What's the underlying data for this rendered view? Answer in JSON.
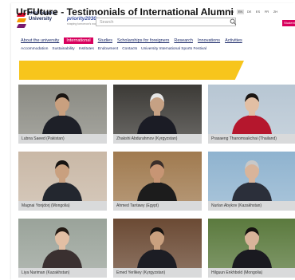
{
  "header": {
    "logo_lines": [
      "Ural Federal",
      "University"
    ],
    "priority_label": "priority2030",
    "priority_sub": "shaping tomorrow's world, today",
    "search_placeholder": "Search",
    "languages": [
      "RU",
      "EN",
      "DE",
      "ES",
      "FR",
      "ZH"
    ],
    "active_language": "EN",
    "student_button": "Student"
  },
  "nav": {
    "primary": [
      "About the university",
      "International",
      "Studies",
      "Scholarships for foreigners",
      "Research",
      "Innovations",
      "Activities"
    ],
    "active": "International",
    "secondary": [
      "Accommodation",
      "Sustainability",
      "Institutes",
      "Endowment",
      "Contacts",
      "University International Sports Festival"
    ]
  },
  "page_title": "UrFUture - Testimonials of International Alumni",
  "alumni": [
    {
      "caption": "Lubna Saeed (Pakistan)",
      "icon": "person-photo",
      "bg": "#8a8a82",
      "skin": "#c9a07f",
      "cloth": "#1e2028",
      "hair": "#1a1512"
    },
    {
      "caption": "Zhakshi Abdurahmov (Kyrgyzstan)",
      "icon": "person-photo",
      "bg": "#3c3a36",
      "skin": "#c6a184",
      "cloth": "#1b1c25",
      "hair": "#e6e6e6"
    },
    {
      "caption": "Prasaeng Thanomsakchai (Thailand)",
      "icon": "person-photo",
      "bg": "#b7c6d3",
      "skin": "#e2bfa4",
      "cloth": "#b5172d",
      "hair": "#1a1512"
    },
    {
      "caption": "Magnai Yonjdorj (Mongolia)",
      "icon": "person-photo",
      "bg": "#c9b8a6",
      "skin": "#c9a07f",
      "cloth": "#23272f",
      "hair": "#161311"
    },
    {
      "caption": "Ahmed Tantawy (Egypt)",
      "icon": "person-photo",
      "bg": "#a07a4f",
      "skin": "#c79574",
      "cloth": "#1c1c1c",
      "hair": "#3a2e2a"
    },
    {
      "caption": "Nurlan Abykov (Kazakhstan)",
      "icon": "person-photo",
      "bg": "#8fb3cf",
      "skin": "#d8b49a",
      "cloth": "#2b2f3a",
      "hair": "#c8c8c8"
    },
    {
      "caption": "Liya Nariman (Kazakhstan)",
      "icon": "person-photo",
      "bg": "#9aa39a",
      "skin": "#e2bfa4",
      "cloth": "#3a3030",
      "hair": "#241a14"
    },
    {
      "caption": "Emed Yerlikey (Kyrgyzstan)",
      "icon": "person-photo",
      "bg": "#6b4a34",
      "skin": "#c9a07f",
      "cloth": "#1c1d24",
      "hair": "#161311"
    },
    {
      "caption": "Hilguun Enkhbold (Mongolia)",
      "icon": "person-photo",
      "bg": "#5b7a3e",
      "skin": "#d8b49a",
      "cloth": "#1a1a20",
      "hair": "#161311"
    }
  ],
  "colors": {
    "accent": "#d8005d",
    "banner": "#f7c51c",
    "nav": "#1f2d6b",
    "caption_bg": "#d9dadb"
  }
}
